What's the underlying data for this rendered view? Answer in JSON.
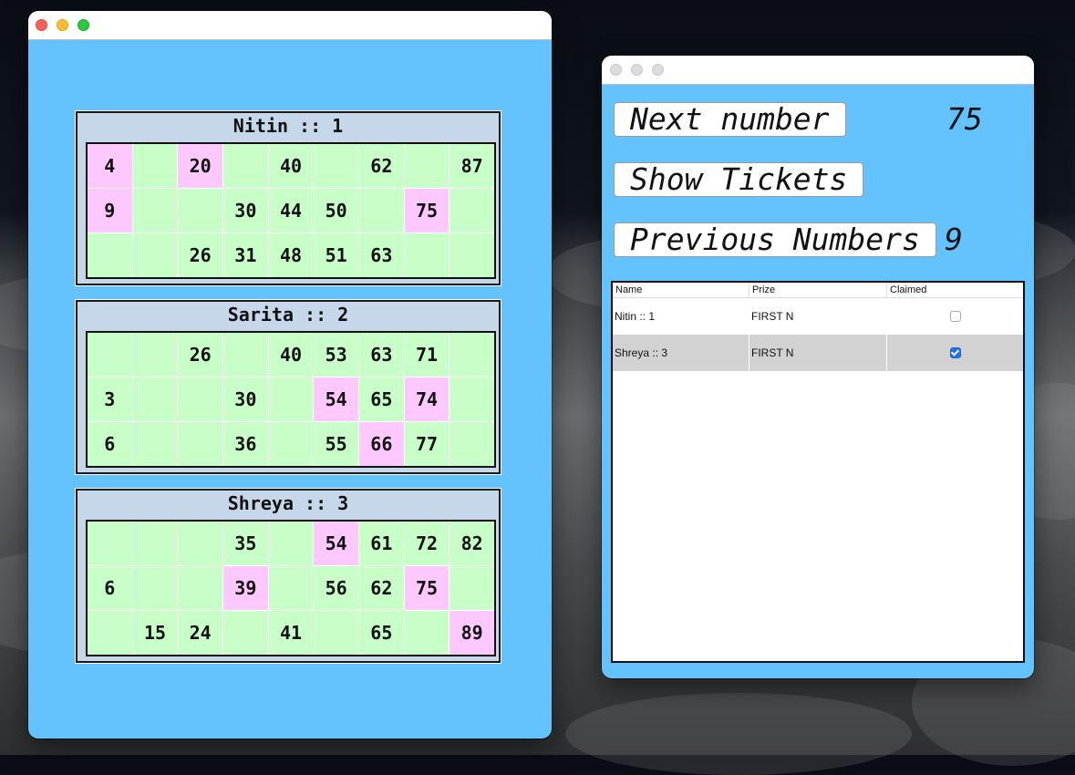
{
  "tickets_window": {
    "controls": [
      "close",
      "minimize",
      "zoom"
    ],
    "tickets": [
      {
        "title": "Nitin :: 1",
        "rows": [
          [
            "4",
            "",
            "20",
            "",
            "40",
            "",
            "62",
            "",
            "87"
          ],
          [
            "9",
            "",
            "",
            "30",
            "44",
            "50",
            "",
            "75",
            ""
          ],
          [
            "",
            "",
            "26",
            "31",
            "48",
            "51",
            "63",
            "",
            ""
          ]
        ],
        "marked": [
          "4",
          "20",
          "9",
          "75"
        ]
      },
      {
        "title": "Sarita :: 2",
        "rows": [
          [
            "",
            "",
            "26",
            "",
            "40",
            "53",
            "63",
            "71",
            ""
          ],
          [
            "3",
            "",
            "",
            "30",
            "",
            "54",
            "65",
            "74",
            ""
          ],
          [
            "6",
            "",
            "",
            "36",
            "",
            "55",
            "66",
            "77",
            ""
          ]
        ],
        "marked": [
          "54",
          "74",
          "66"
        ]
      },
      {
        "title": "Shreya :: 3",
        "rows": [
          [
            "",
            "",
            "",
            "35",
            "",
            "54",
            "61",
            "72",
            "82"
          ],
          [
            "6",
            "",
            "",
            "39",
            "",
            "56",
            "62",
            "75",
            ""
          ],
          [
            "",
            "15",
            "24",
            "",
            "41",
            "",
            "65",
            "",
            "89"
          ]
        ],
        "marked": [
          "54",
          "39",
          "75",
          "89"
        ]
      }
    ]
  },
  "control_window": {
    "next_number_label": "Next number",
    "next_number_value": "75",
    "show_tickets_label": "Show Tickets",
    "previous_numbers_label": "Previous Numbers",
    "previous_numbers_value": "9",
    "table": {
      "columns": [
        "Name",
        "Prize",
        "Claimed"
      ],
      "rows": [
        {
          "name": "Nitin :: 1",
          "prize": "FIRST N",
          "claimed": false,
          "selected": false
        },
        {
          "name": "Shreya :: 3",
          "prize": "FIRST N",
          "claimed": true,
          "selected": true
        }
      ]
    }
  },
  "colors": {
    "window_background": "#64c2ff",
    "cell_unmarked": "#c8fec8",
    "cell_marked": "#fdc8fd",
    "ticket_background": "#c6d7ea",
    "checkbox_checked": "#1a73e8"
  }
}
